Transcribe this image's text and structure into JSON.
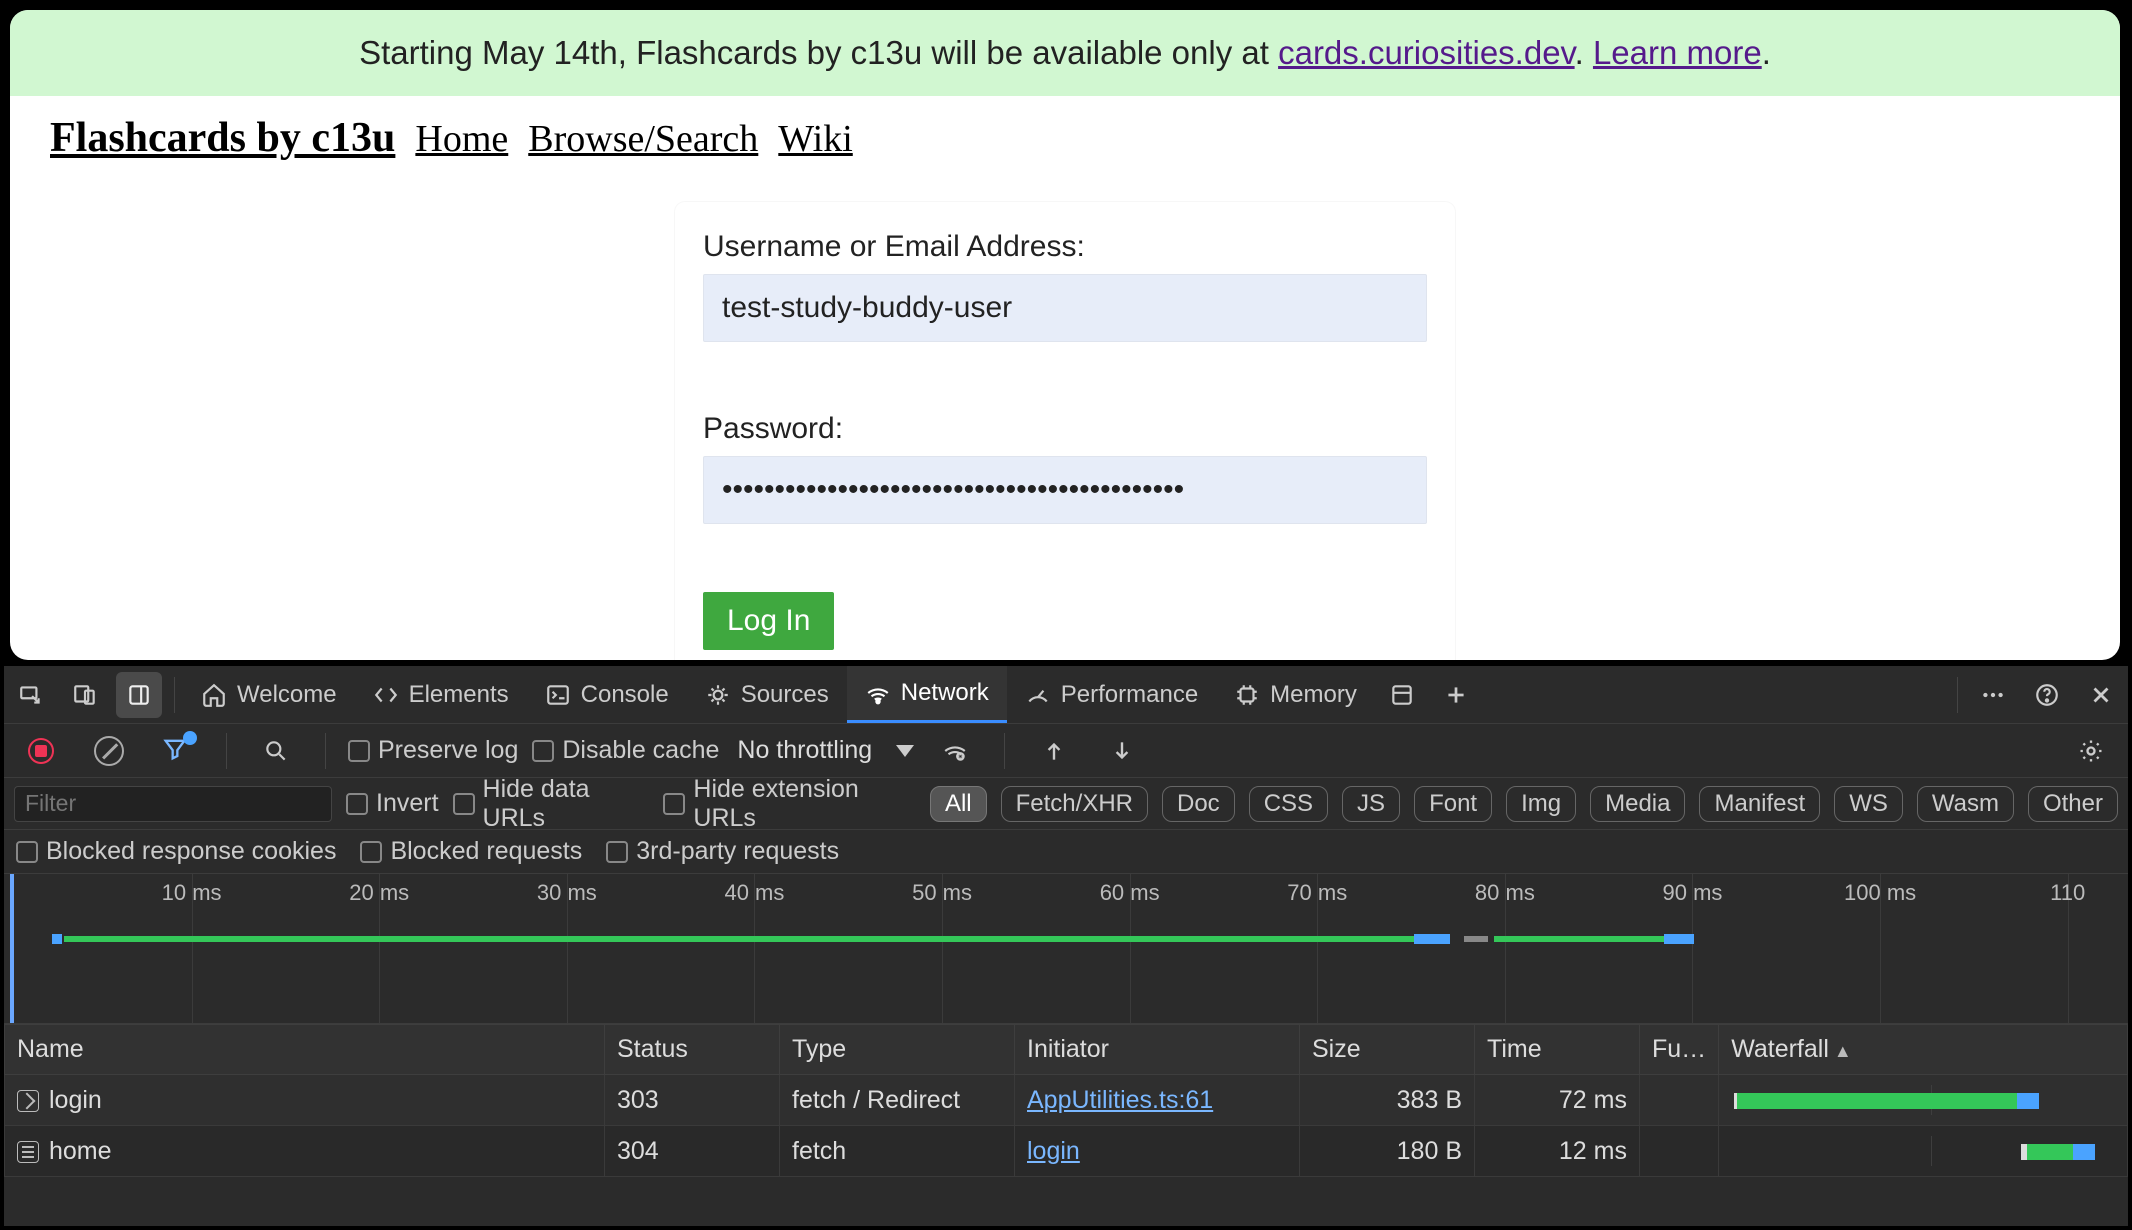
{
  "banner": {
    "text_before": "Starting May 14th, Flashcards by c13u will be available only at ",
    "link1": "cards.curiosities.dev",
    "mid": ". ",
    "link2": "Learn more",
    "after": "."
  },
  "nav": {
    "brand": "Flashcards by c13u",
    "home": "Home",
    "browse": "Browse/Search",
    "wiki": "Wiki"
  },
  "login": {
    "username_label": "Username or Email Address:",
    "username_value": "test-study-buddy-user",
    "password_label": "Password:",
    "password_value": "••••••••••••••••••••••••••••••••••••••••••••",
    "button": "Log In"
  },
  "devtools": {
    "tabs": {
      "welcome": "Welcome",
      "elements": "Elements",
      "console": "Console",
      "sources": "Sources",
      "network": "Network",
      "performance": "Performance",
      "memory": "Memory"
    },
    "toolbar": {
      "preserve": "Preserve log",
      "disable_cache": "Disable cache",
      "throttling": "No throttling"
    },
    "filters": {
      "placeholder": "Filter",
      "invert": "Invert",
      "hide_data": "Hide data URLs",
      "hide_ext": "Hide extension URLs",
      "all": "All",
      "fetch": "Fetch/XHR",
      "doc": "Doc",
      "css": "CSS",
      "js": "JS",
      "font": "Font",
      "img": "Img",
      "media": "Media",
      "manifest": "Manifest",
      "ws": "WS",
      "wasm": "Wasm",
      "other": "Other",
      "blocked_cookies": "Blocked response cookies",
      "blocked_req": "Blocked requests",
      "third_party": "3rd-party requests"
    },
    "timeline_ticks": [
      "10 ms",
      "20 ms",
      "30 ms",
      "40 ms",
      "50 ms",
      "60 ms",
      "70 ms",
      "80 ms",
      "90 ms",
      "100 ms",
      "110"
    ],
    "table": {
      "headers": {
        "name": "Name",
        "status": "Status",
        "type": "Type",
        "initiator": "Initiator",
        "size": "Size",
        "time": "Time",
        "fulfilled": "Fu…",
        "waterfall": "Waterfall"
      },
      "rows": [
        {
          "name": "login",
          "status": "303",
          "type": "fetch / Redirect",
          "initiator": "AppUtilities.ts:61",
          "size": "383 B",
          "time": "72 ms",
          "icon": "redirect"
        },
        {
          "name": "home",
          "status": "304",
          "type": "fetch",
          "initiator": "login",
          "size": "180 B",
          "time": "12 ms",
          "icon": "doc"
        }
      ]
    }
  }
}
